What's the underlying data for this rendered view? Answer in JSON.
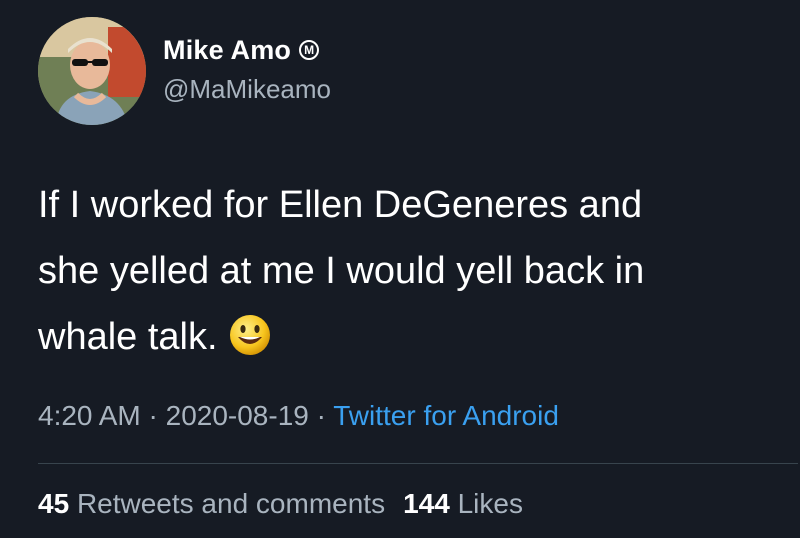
{
  "user": {
    "display_name": "Mike Amo",
    "badge_letter": "M",
    "handle": "@MaMikeamo"
  },
  "tweet": {
    "lines": [
      "If I worked for Ellen DeGeneres and",
      "she yelled at me I would yell back in",
      "whale talk."
    ],
    "emoji": "smiling-face-emoji"
  },
  "meta": {
    "time": "4:20 AM",
    "separator": "·",
    "date": "2020-08-19",
    "source": "Twitter for Android"
  },
  "stats": {
    "retweets_count": "45",
    "retweets_label": "Retweets and comments",
    "likes_count": "144",
    "likes_label": "Likes"
  },
  "colors": {
    "background": "#161b24",
    "secondary_text": "#a9b4bf",
    "link": "#3aa0f0",
    "divider": "#38444d"
  }
}
